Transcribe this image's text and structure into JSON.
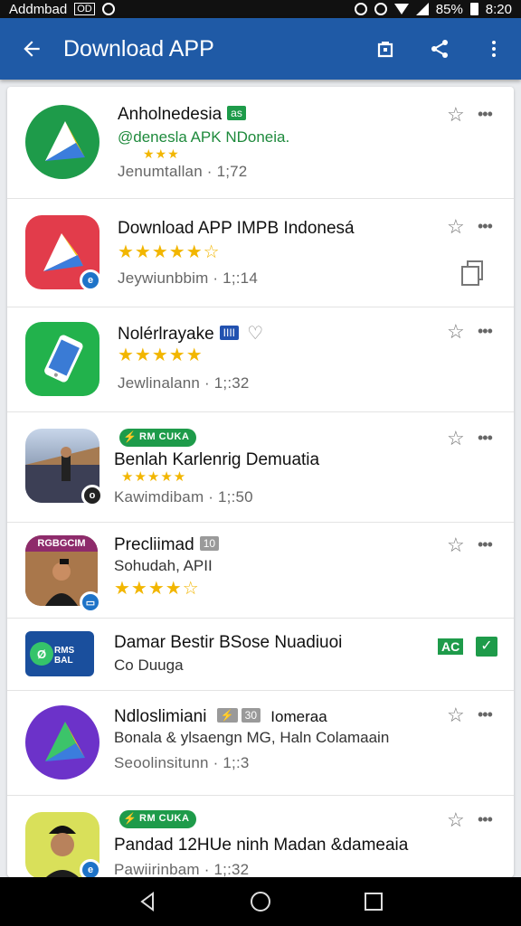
{
  "status_bar": {
    "left_text": "Addmbad",
    "left_badge": "OD",
    "battery": "85%",
    "time": "8:20"
  },
  "app_bar": {
    "title": "Download APP"
  },
  "apps": [
    {
      "name": "Anholnedesia",
      "tag": "as",
      "sub": "@denesla APK NDoneia.",
      "stars": "★★★",
      "meta": "Jenumtallan · 1;72",
      "icon": "green-triangle-icon"
    },
    {
      "name": "Download APP IMPB Indonesá",
      "stars": "★★★★★☆",
      "meta": "Jeywiunbbim · 1;:14",
      "icon": "red-triangle-icon"
    },
    {
      "name": "Nolérlrayake",
      "tag": "IIII",
      "stars": "★★★★★",
      "meta": "Jewlinalann · 1;:32",
      "icon": "green-phone-icon"
    },
    {
      "name": "Benlah Karlenrig Demuatia",
      "promo": "RM CUKA",
      "stars": "★★★★★",
      "meta": "Kawimdibam · 1;:50",
      "icon": "train-station-icon"
    },
    {
      "name": "Precliimad",
      "tag": "10",
      "sub": "Sohudah, APII",
      "stars": "★★★★☆",
      "icon": "man-portrait-icon",
      "icon_text": "RGBGCIM"
    },
    {
      "name": "Damar Bestir BSose Nuadiuoi",
      "sub": "Co Duuga",
      "badge_text": "AC",
      "icon": "blue-logo-icon",
      "icon_text": "RMS BAL"
    },
    {
      "name": "Ndloslimiani",
      "tag": "30",
      "name_suffix": "Iomeraa",
      "sub": "Bonala & ylsaengn MG, Haln Colamaain",
      "meta": "Seoolinsitunn · 1;:3",
      "icon": "purple-triangle-icon"
    },
    {
      "name": "Pandad 12HUe ninh Madan &dameaia",
      "promo": "RM CUKA",
      "meta": "Pawiirinbam · 1;:32",
      "icon": "man-cap-icon"
    }
  ]
}
